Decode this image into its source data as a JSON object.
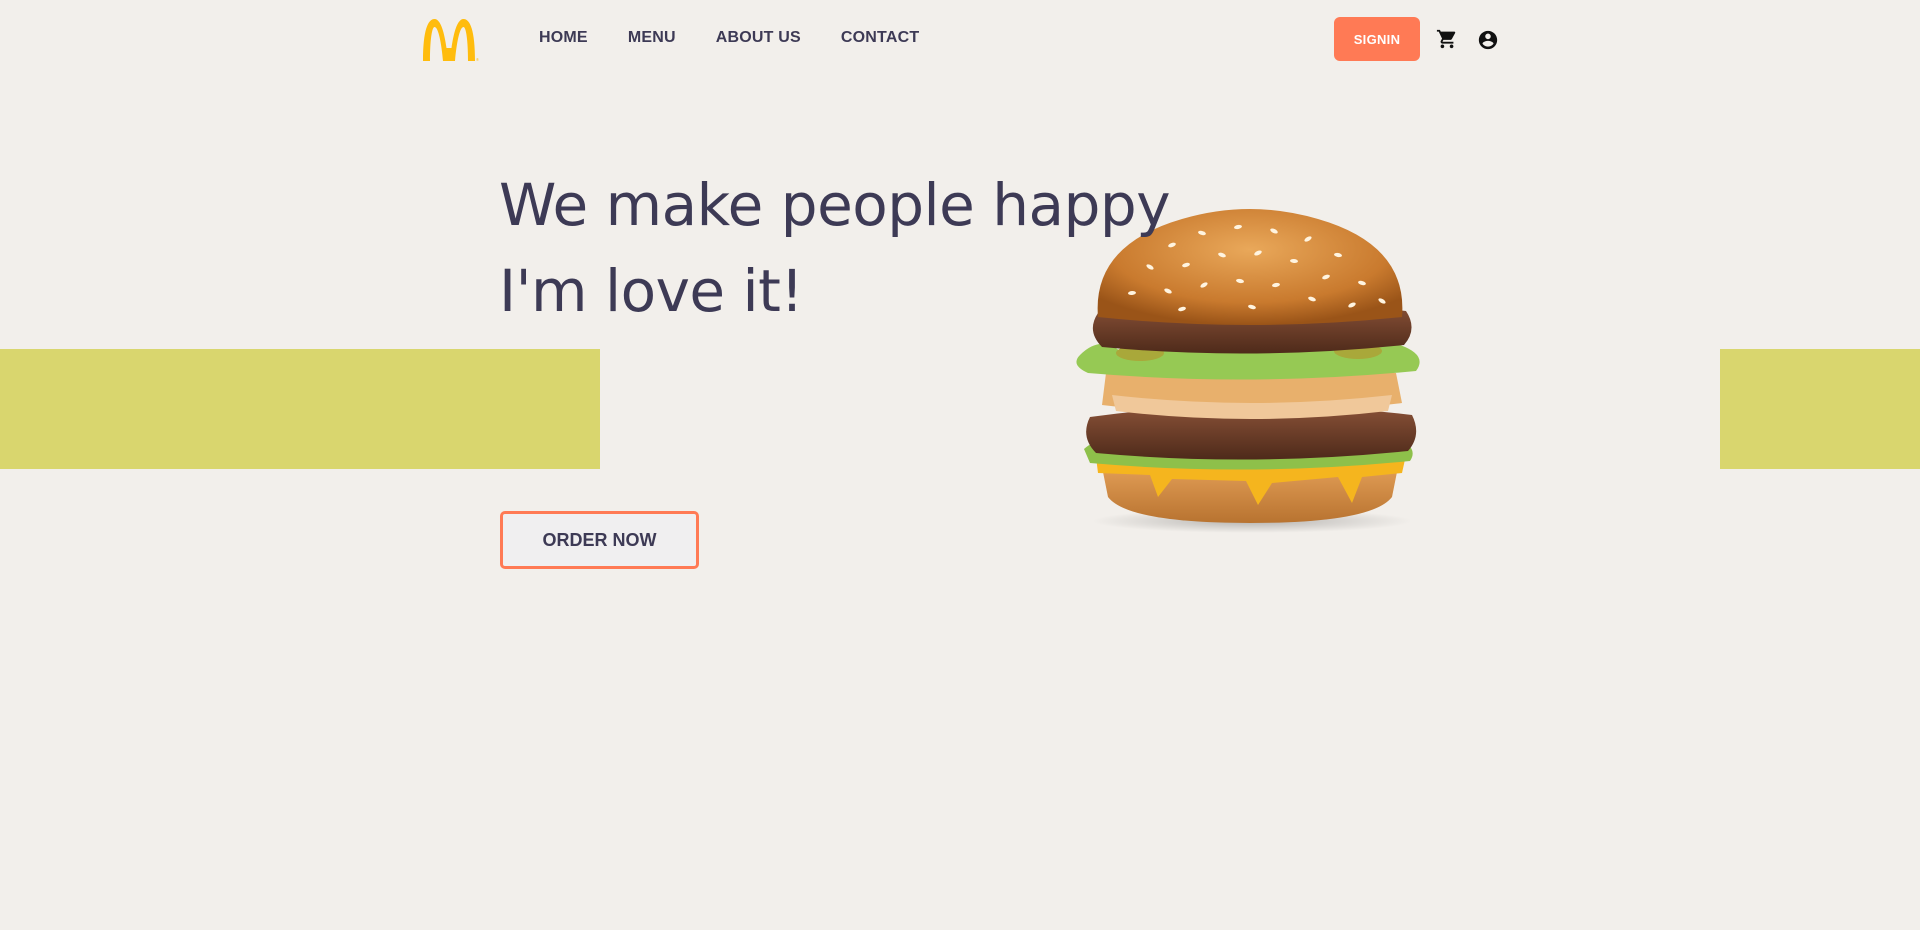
{
  "header": {
    "logo_icon": "golden-arches-logo",
    "nav": [
      {
        "label": "HOME"
      },
      {
        "label": "MENU"
      },
      {
        "label": "ABOUT US"
      },
      {
        "label": "CONTACT"
      }
    ],
    "signin_label": "SIGNIN",
    "cart_icon": "cart-icon",
    "account_icon": "account-circle-icon"
  },
  "hero": {
    "headline_line1": "We make people happy",
    "headline_line2": "I'm love it!",
    "order_label": "ORDER NOW",
    "image_icon": "burger-image"
  },
  "colors": {
    "background": "#f2efeb",
    "accent": "#ff7a55",
    "band": "#d9d66e",
    "text": "#3d3a55",
    "logo": "#ffbc0d"
  }
}
